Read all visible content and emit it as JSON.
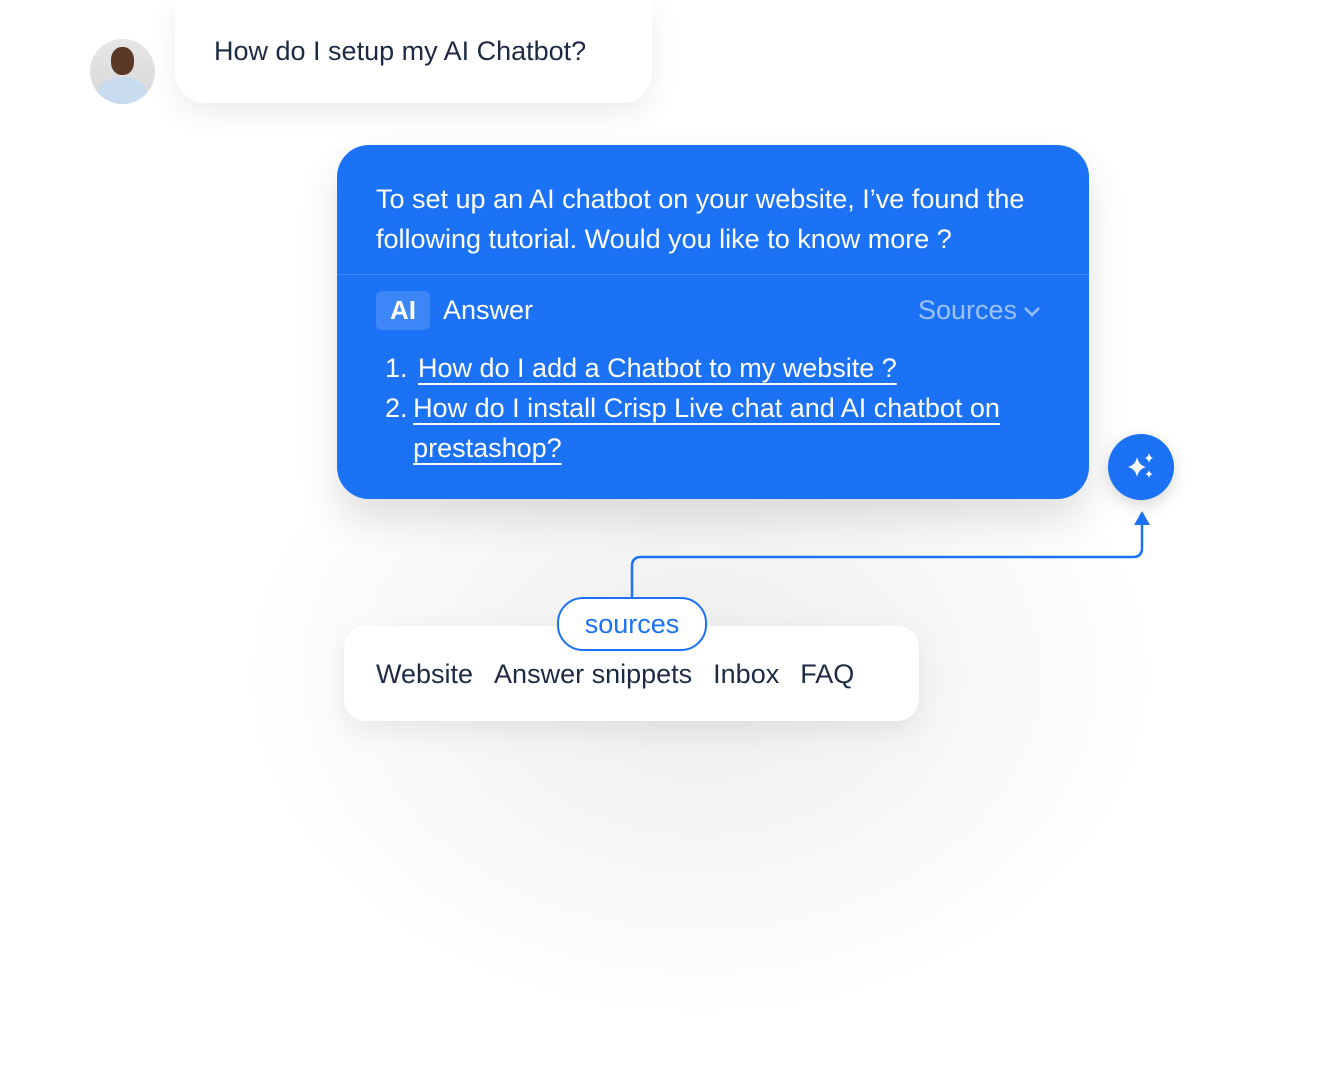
{
  "user": {
    "question": "How do I setup my AI Chatbot?",
    "avatar": "user-avatar-photo"
  },
  "ai": {
    "message": "To set up an AI chatbot on your website, I’ve found the following tutorial. Would you like to know more ?",
    "badge": "AI",
    "answer_label": "Answer",
    "sources_toggle": "Sources",
    "links": [
      {
        "num": "1.",
        "text": "How do I add a Chatbot to my website ?"
      },
      {
        "num": "2.",
        "text": "How do I install Crisp Live chat and AI chatbot on prestashop?"
      }
    ],
    "accent": "#1b72f5"
  },
  "sources": {
    "label": "sources",
    "items": [
      "Website",
      "Answer snippets",
      "Inbox",
      "FAQ"
    ]
  }
}
